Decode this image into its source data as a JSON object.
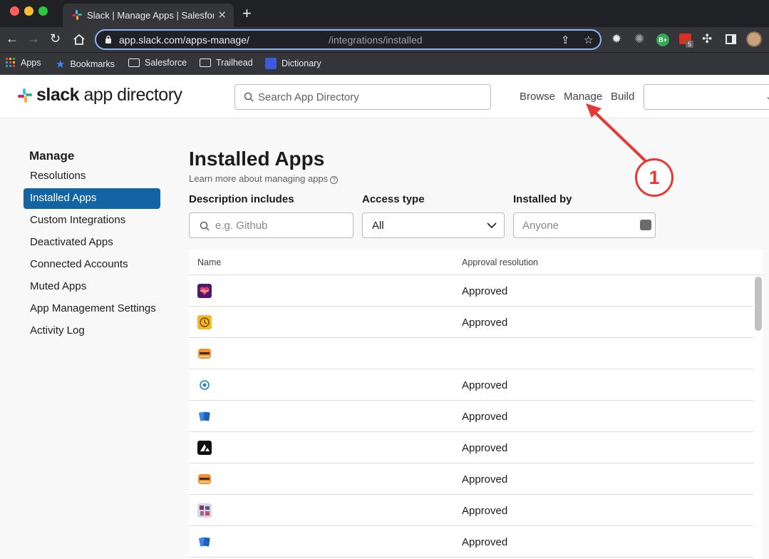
{
  "browser": {
    "tab_title": "Slack | Manage Apps | Salesfor",
    "tab_close": "✕",
    "new_tab": "+",
    "url_host": "app.slack.com/apps-manage/",
    "url_path": "/integrations/installed",
    "extension_badge": "5",
    "profile_initials": "B+",
    "bookmarks": [
      "Apps",
      "Bookmarks",
      "Salesforce",
      "Trailhead",
      "Dictionary"
    ]
  },
  "header": {
    "brand_bold": "slack",
    "brand_rest": " app directory",
    "search_placeholder": "Search App Directory",
    "nav": [
      "Browse",
      "Manage",
      "Build"
    ]
  },
  "sidebar": {
    "title": "Manage",
    "items": [
      {
        "label": "Resolutions",
        "active": false
      },
      {
        "label": "Installed Apps",
        "active": true
      },
      {
        "label": "Custom Integrations",
        "active": false
      },
      {
        "label": "Deactivated Apps",
        "active": false
      },
      {
        "label": "Connected Accounts",
        "active": false
      },
      {
        "label": "Muted Apps",
        "active": false
      },
      {
        "label": "App Management Settings",
        "active": false
      },
      {
        "label": "Activity Log",
        "active": false
      }
    ]
  },
  "main": {
    "title": "Installed Apps",
    "learn_more": "Learn more about managing apps",
    "filters": {
      "description_label": "Description includes",
      "description_placeholder": "e.g. Github",
      "access_label": "Access type",
      "access_value": "All",
      "installed_by_label": "Installed by",
      "installed_by_placeholder": "Anyone"
    },
    "table": {
      "columns": [
        "Name",
        "Approval resolution"
      ],
      "rows": [
        {
          "icon": "heart-pulse-app-icon",
          "status": "Approved"
        },
        {
          "icon": "yellow-clock-app-icon",
          "status": "Approved"
        },
        {
          "icon": "orange-bus-app-icon",
          "status": ""
        },
        {
          "icon": "blue-circle-app-icon",
          "status": "Approved"
        },
        {
          "icon": "blue-cards-app-icon",
          "status": "Approved"
        },
        {
          "icon": "black-mountain-app-icon",
          "status": "Approved"
        },
        {
          "icon": "orange-bus-app-icon",
          "status": "Approved"
        },
        {
          "icon": "mosaic-app-icon",
          "status": "Approved"
        },
        {
          "icon": "blue-cards-app-icon",
          "status": "Approved"
        }
      ]
    }
  },
  "annotation": {
    "step_number": "1",
    "color": "#e53935"
  },
  "colors": {
    "active_blue": "#1264a3",
    "browser_dark": "#202124",
    "browser_toolbar": "#35363a"
  }
}
